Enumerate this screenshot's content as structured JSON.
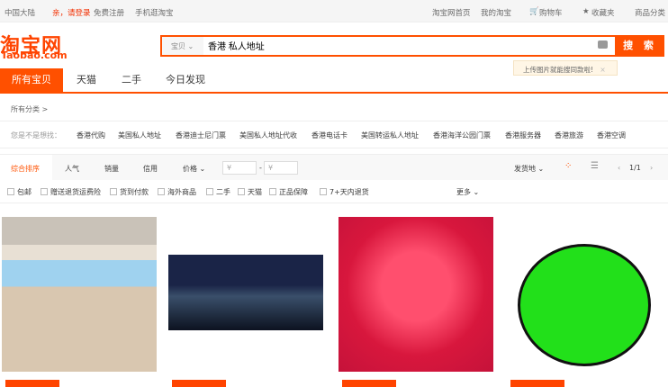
{
  "topbar": {
    "region": "中国大陆",
    "login": "亲，请登录",
    "register": "免费注册",
    "mobile": "手机逛淘宝",
    "home": "淘宝网首页",
    "my": "我的淘宝",
    "cart": "购物车",
    "fav": "收藏夹",
    "categories": "商品分类"
  },
  "logo": {
    "cn": "淘宝网",
    "en": "Taobao.com"
  },
  "search": {
    "category": "宝贝",
    "query": "香港 私人地址",
    "button": "搜 索",
    "tip": "上传图片就能搜同款啦!",
    "tip_close": "×"
  },
  "tabs": [
    "所有宝贝",
    "天猫",
    "二手",
    "今日发现"
  ],
  "all_categories": "所有分类 >",
  "suggestions": {
    "label": "您是不是想找：",
    "items": [
      "香港代购",
      "美国私人地址",
      "香港迪士尼门票",
      "美国私人地址代收",
      "香港电话卡",
      "美国转运私人地址",
      "香港海洋公园门票",
      "香港服务器",
      "香港旅游",
      "香港空调"
    ]
  },
  "sort": {
    "items": [
      "综合排序",
      "人气",
      "销量",
      "信用",
      "价格"
    ],
    "price_min": "¥",
    "price_max": "¥",
    "location": "发货地",
    "page": "1/1"
  },
  "filters": {
    "items": [
      "包邮",
      "赠送退货运费险",
      "货到付款",
      "海外商品",
      "二手",
      "天猫",
      "正品保障",
      "7+天内退货"
    ],
    "more": "更多"
  },
  "colors": {
    "accent": "#ff5000"
  }
}
